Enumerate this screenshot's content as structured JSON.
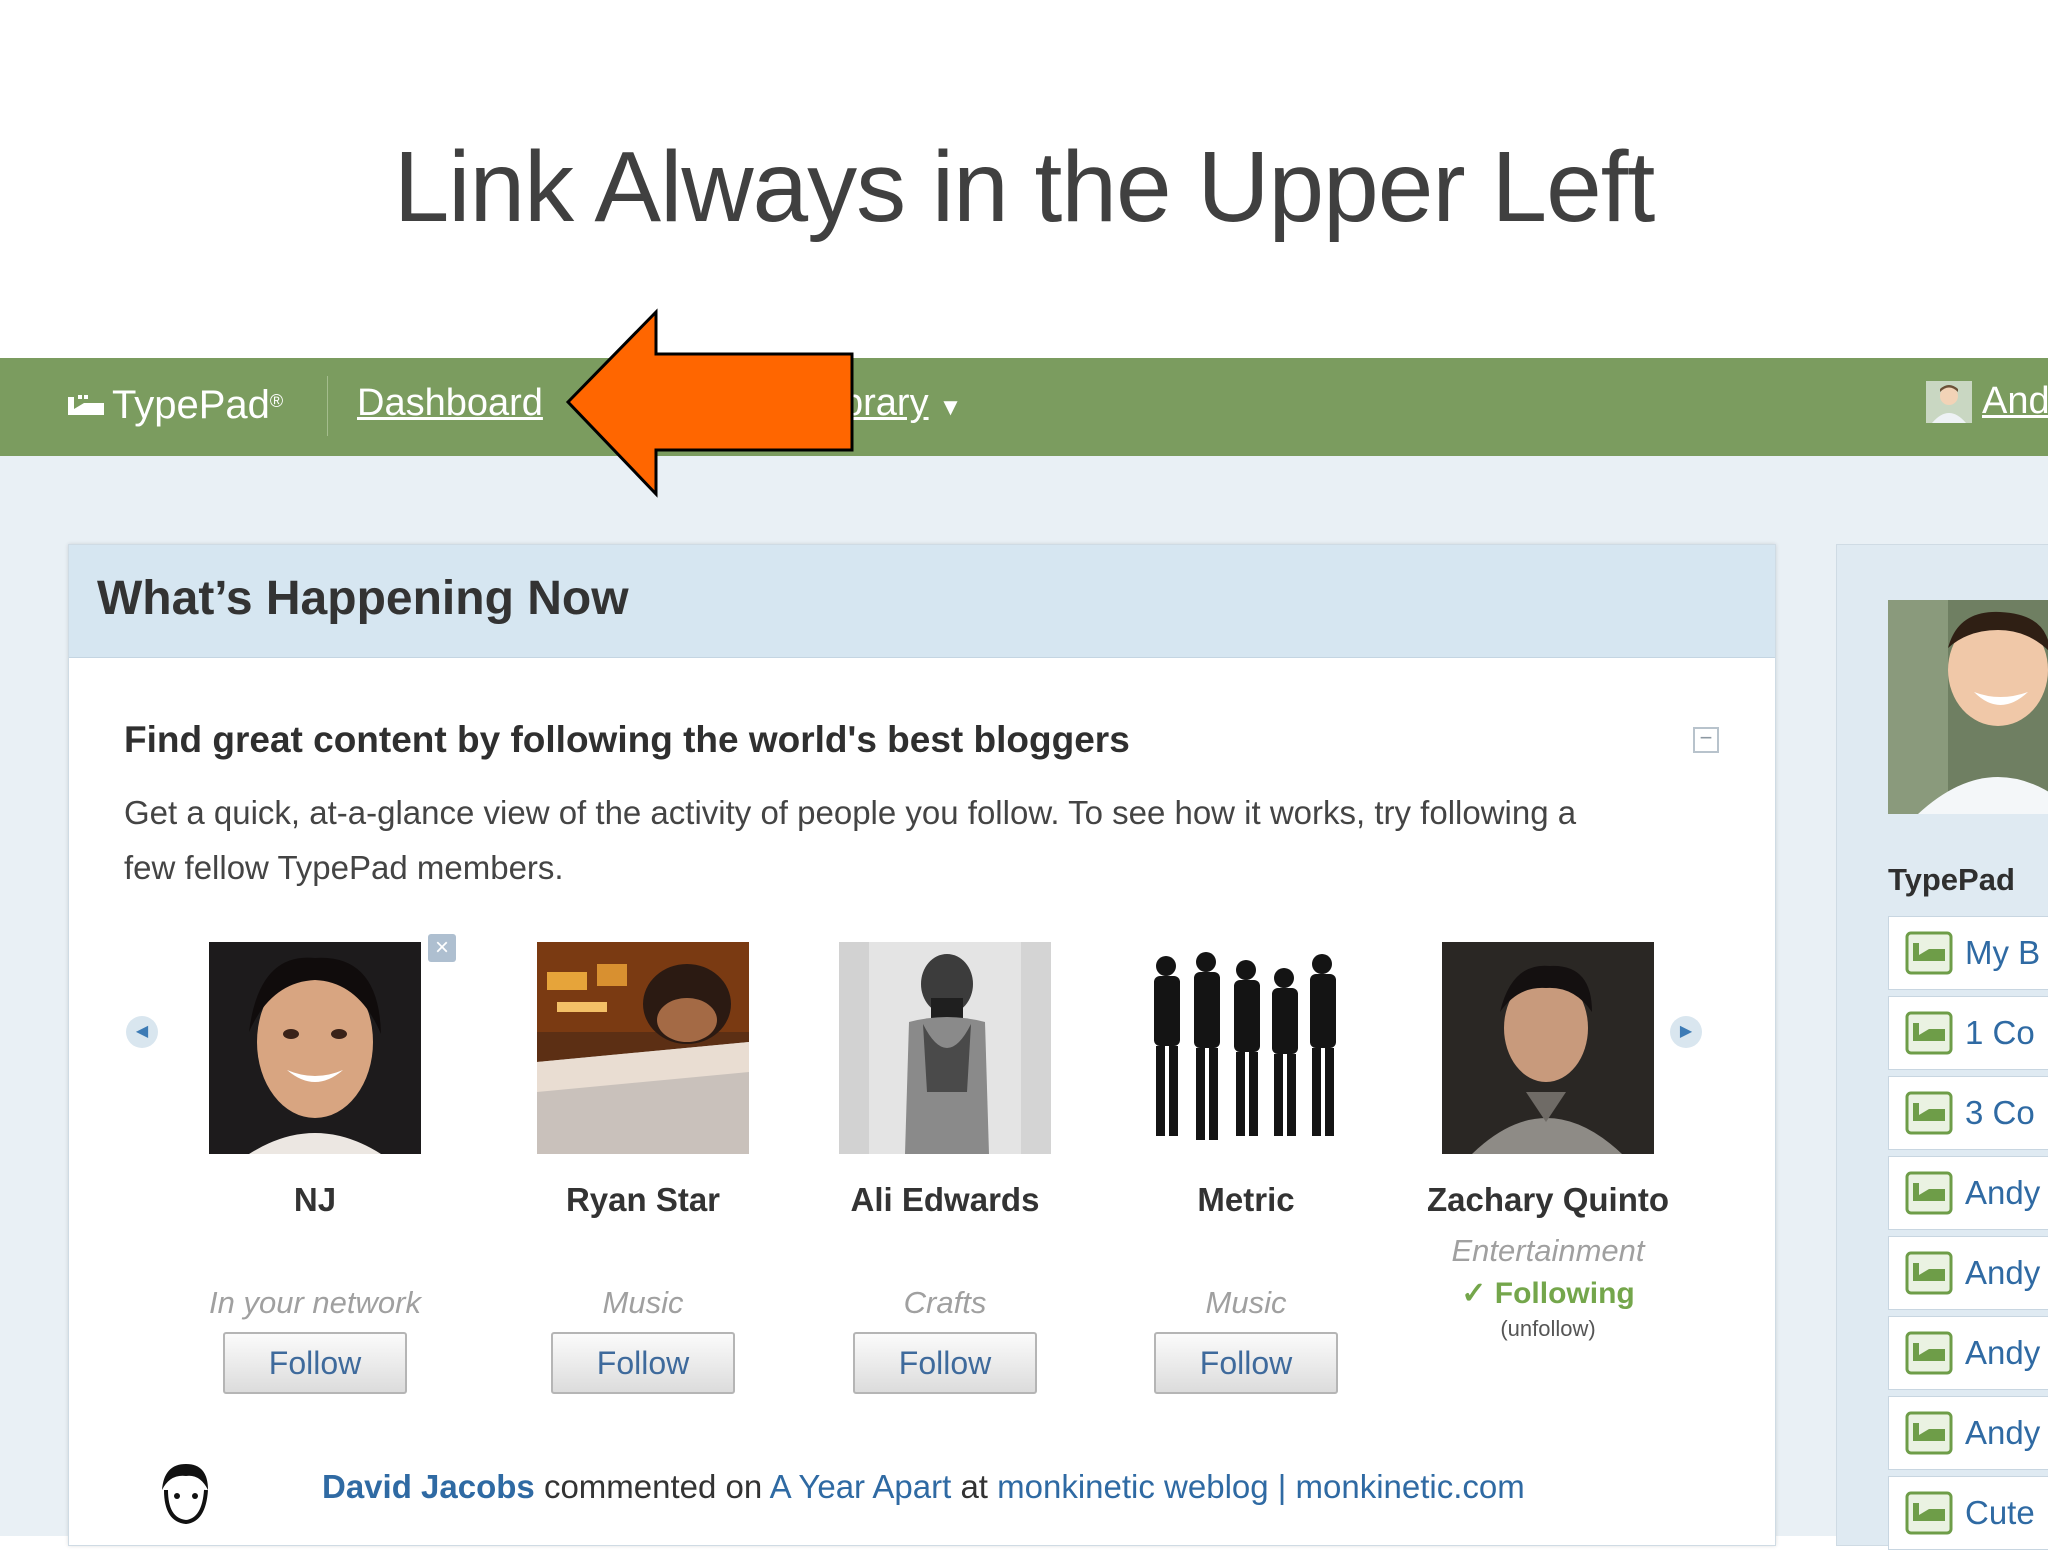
{
  "slide": {
    "title": "Link Always in the Upper Left"
  },
  "navbar": {
    "logo_text": "TypePad",
    "logo_mark": "®",
    "links": [
      "Dashboard",
      "brary"
    ],
    "user_name": "And"
  },
  "colors": {
    "navbar": "#7b9c5f",
    "arrow": "#ff6600",
    "link": "#2f6aa3",
    "following": "#74a64b"
  },
  "panel": {
    "title": "What’s Happening Now",
    "section_heading": "Find great content by following the world's best bloggers",
    "description": "Get a quick, at-a-glance view of the activity of people you follow. To see how it works, try following a few fellow TypePad members.",
    "bloggers": [
      {
        "name": "NJ",
        "category": "In your network",
        "action": "Follow"
      },
      {
        "name": "Ryan Star",
        "category": "Music",
        "action": "Follow"
      },
      {
        "name": "Ali Edwards",
        "category": "Crafts",
        "action": "Follow"
      },
      {
        "name": "Metric",
        "category": "Music",
        "action": "Follow"
      },
      {
        "name": "Zachary Quinto",
        "category": "Entertainment",
        "following": "Following",
        "unfollow": "(unfollow)"
      }
    ],
    "activity": {
      "user": "David Jacobs",
      "verb": "commented on",
      "post": "A Year Apart",
      "at": "at",
      "blog": "monkinetic weblog | monkinetic.com"
    }
  },
  "sidebar": {
    "title": "TypePad",
    "items": [
      "My B",
      "1 Co",
      "3 Co",
      "Andy",
      "Andy",
      "Andy",
      "Andy",
      "Cute"
    ]
  },
  "icons": {
    "arrow": "left-arrow-icon",
    "prev": "chevron-left-icon",
    "next": "chevron-right-icon",
    "remove": "close-icon",
    "collapse": "minus-icon",
    "check": "checkmark-icon",
    "blog": "blog-icon"
  }
}
